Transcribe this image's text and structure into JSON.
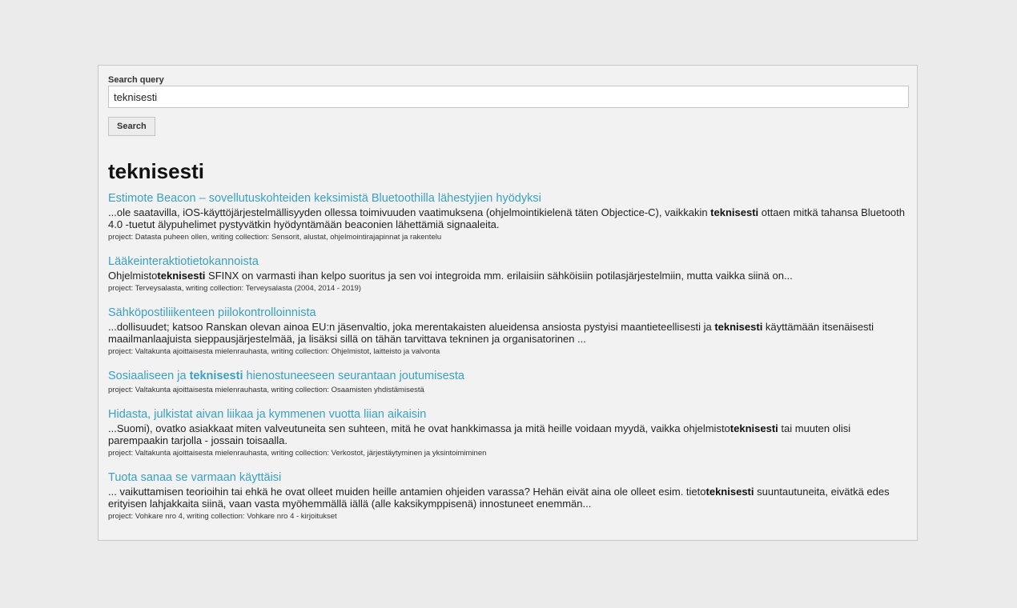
{
  "search": {
    "label": "Search query",
    "value": "teknisesti",
    "button": "Search"
  },
  "heading": "teknisesti",
  "results": [
    {
      "title": [
        "Estimote Beacon – sovellutuskohteiden keksimistä Bluetoothilla lähestyjien hyödyksi"
      ],
      "snippet": [
        "...ole saatavilla, iOS-käyttöjärjestelmällisyyden ollessa toimivuuden vaatimuksena (ohjelmointikielenä täten Objectice-C), vaikkakin ",
        "teknisesti",
        " ottaen mitkä tahansa Bluetooth 4.0 -tuetut älypuhelimet pystyvätkin hyödyntämään beaconien lähettämiä signaaleita."
      ],
      "meta": "project: Datasta puheen ollen, writing collection: Sensorit, alustat, ohjelmointirajapinnat ja rakentelu"
    },
    {
      "title": [
        "Lääkeinteraktiotietokannoista"
      ],
      "snippet": [
        "Ohjelmisto",
        "teknisesti",
        " SFINX on varmasti ihan kelpo suoritus ja sen voi integroida mm. erilaisiin sähköisiin potilasjärjestelmiin, mutta vaikka siinä on..."
      ],
      "meta": "project: Terveysalasta, writing collection: Terveysalasta (2004, 2014 - 2019)"
    },
    {
      "title": [
        "Sähköpostiliikenteen piilokontrolloinnista"
      ],
      "snippet": [
        "...dollisuudet; katsoo Ranskan olevan ainoa EU:n jäsenvaltio, joka merentakaisten alueidensa ansiosta pystyisi maantieteellisesti ja ",
        "teknisesti",
        " käyttämään itsenäisesti maailmanlaajuista sieppausjärjestelmää, ja lisäksi sillä on tähän tarvittava tekninen ja organisatorinen ..."
      ],
      "meta": "project: Valtakunta ajoittaisesta mielenrauhasta, writing collection: Ohjelmistot, laitteisto ja valvonta"
    },
    {
      "title": [
        "Sosiaaliseen ja ",
        "teknisesti",
        " hienostuneeseen seurantaan joutumisesta"
      ],
      "snippet": [],
      "meta": "project: Valtakunta ajoittaisesta mielenrauhasta, writing collection: Osaamisten yhdistämisestä"
    },
    {
      "title": [
        "Hidasta, julkistat aivan liikaa ja kymmenen vuotta liian aikaisin"
      ],
      "snippet": [
        "...Suomi), ovatko asiakkaat miten valveutuneita sen suhteen, mitä he ovat hankkimassa ja mitä heille voidaan myydä, vaikka ohjelmisto",
        "teknisesti",
        " tai muuten olisi parempaakin tarjolla - jossain toisaalla."
      ],
      "meta": "project: Valtakunta ajoittaisesta mielenrauhasta, writing collection: Verkostot, järjestäytyminen ja yksintoimiminen"
    },
    {
      "title": [
        "Tuota sanaa se varmaan käyttäisi"
      ],
      "snippet": [
        "... vaikuttamisen teorioihin tai ehkä he ovat olleet muiden heille antamien ohjeiden varassa? Hehän eivät aina ole olleet esim. tieto",
        "teknisesti",
        " suuntautuneita, eivätkä edes erityisen lahjakkaita siinä, vaan vasta myöhemmällä iällä (alle kaksikymppisenä) innostuneet enemmän..."
      ],
      "meta": "project: Vohkare nro 4, writing collection: Vohkare nro 4 - kirjoitukset"
    }
  ]
}
